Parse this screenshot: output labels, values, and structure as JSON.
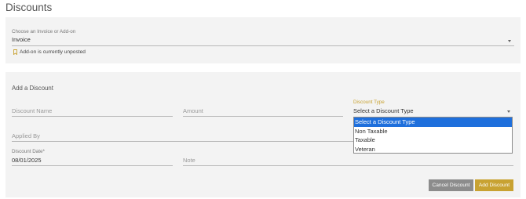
{
  "page": {
    "title": "Discounts"
  },
  "invoice_section": {
    "choose_label": "Choose an Invoice or Add-on",
    "choose_value": "Invoice",
    "notice": "Add-on is currently unposted"
  },
  "discount_section": {
    "title": "Add a Discount",
    "discount_name_placeholder": "Discount Name",
    "amount_placeholder": "Amount",
    "discount_type_label": "Discount Type",
    "discount_type_value": "Select a Discount Type",
    "discount_type_options": [
      "Select a Discount Type",
      "Non Taxable",
      "Taxable",
      "Veteran"
    ],
    "discount_type_selected_index": 0,
    "applied_by_placeholder": "Applied By",
    "discount_date_label": "Discount Date*",
    "discount_date_value": "08/01/2025",
    "note_placeholder": "Note"
  },
  "buttons": {
    "cancel_label": "Cancel Discount",
    "add_label": "Add Discount"
  },
  "colors": {
    "accent_gold": "#c8a232",
    "cancel_gray": "#8c8c8c",
    "selected_blue": "#1e6fdc",
    "card_bg": "#f3f3f3"
  },
  "icons": {
    "notice": "bookmark-icon",
    "dropdown": "caret-down-icon"
  }
}
